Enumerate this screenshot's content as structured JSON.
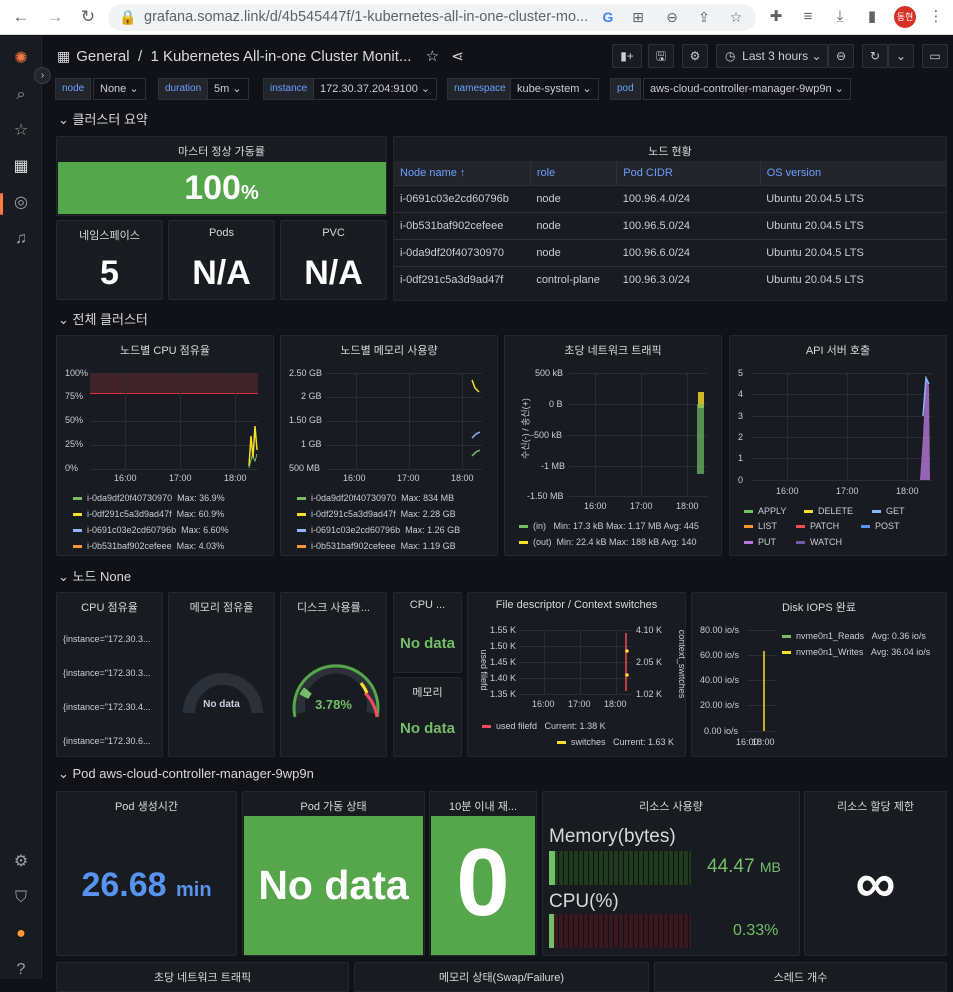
{
  "browser": {
    "url_host": "grafana.somaz.link",
    "url_path": "/d/4b545447f/1-kubernetes-all-in-one-cluster-mo...",
    "profile_initials": "동현"
  },
  "dashboard": {
    "folder": "General",
    "title": "1 Kubernetes All-in-one Cluster Monit...",
    "time_range": "Last 3 hours"
  },
  "variables": [
    {
      "label": "node",
      "value": "None"
    },
    {
      "label": "duration",
      "value": "5m"
    },
    {
      "label": "instance",
      "value": "172.30.37.204:9100"
    },
    {
      "label": "namespace",
      "value": "kube-system"
    },
    {
      "label": "pod",
      "value": "aws-cloud-controller-manager-9wp9n"
    }
  ],
  "rows": {
    "summary": "클러스터 요약",
    "cluster": "전체 클러스터",
    "node": "노드 None",
    "pod": "Pod aws-cloud-controller-manager-9wp9n"
  },
  "summary": {
    "uptime_title": "마스터 정상 가동률",
    "uptime_value": "100",
    "uptime_unit": "%",
    "ns_title": "네임스페이스",
    "ns_value": "5",
    "pods_title": "Pods",
    "pods_value": "N/A",
    "pvc_title": "PVC",
    "pvc_value": "N/A",
    "nodes_title": "노드 현황",
    "nodes_columns": [
      "Node name ↑",
      "role",
      "Pod CIDR",
      "OS version"
    ],
    "nodes_rows": [
      [
        "i-0691c03e2cd60796b",
        "node",
        "100.96.4.0/24",
        "Ubuntu 20.04.5 LTS"
      ],
      [
        "i-0b531baf902cefeee",
        "node",
        "100.96.5.0/24",
        "Ubuntu 20.04.5 LTS"
      ],
      [
        "i-0da9df20f40730970",
        "node",
        "100.96.6.0/24",
        "Ubuntu 20.04.5 LTS"
      ],
      [
        "i-0df291c5a3d9ad47f",
        "control-plane",
        "100.96.3.0/24",
        "Ubuntu 20.04.5 LTS"
      ]
    ]
  },
  "cluster": {
    "cpu": {
      "title": "노드별 CPU 점유율",
      "yticks": [
        "100%",
        "75%",
        "50%",
        "25%",
        "0%"
      ],
      "xticks": [
        "16:00",
        "17:00",
        "18:00"
      ],
      "legend": [
        {
          "name": "i-0da9df20f40730970",
          "stat": "Max: 36.9%",
          "color": "#73bf69"
        },
        {
          "name": "i-0df291c5a3d9ad47f",
          "stat": "Max: 60.9%",
          "color": "#fade2a"
        },
        {
          "name": "i-0691c03e2cd60796b",
          "stat": "Max: 6.60%",
          "color": "#8ab8ff"
        },
        {
          "name": "i-0b531baf902cefeee",
          "stat": "Max: 4.03%",
          "color": "#ff9830"
        }
      ]
    },
    "mem": {
      "title": "노드별 메모리 사용량",
      "yticks": [
        "2.50 GB",
        "2 GB",
        "1.50 GB",
        "1 GB",
        "500 MB"
      ],
      "xticks": [
        "16:00",
        "17:00",
        "18:00"
      ],
      "legend": [
        {
          "name": "i-0da9df20f40730970",
          "stat": "Max: 834 MB",
          "color": "#73bf69"
        },
        {
          "name": "i-0df291c5a3d9ad47f",
          "stat": "Max: 2.28 GB",
          "color": "#fade2a"
        },
        {
          "name": "i-0691c03e2cd60796b",
          "stat": "Max: 1.26 GB",
          "color": "#8ab8ff"
        },
        {
          "name": "i-0b531baf902cefeee",
          "stat": "Max: 1.19 GB",
          "color": "#ff9830"
        }
      ]
    },
    "net": {
      "title": "초당 네트워크 트래픽",
      "ylabel": "수신(-) / 송신(+)",
      "yticks": [
        "500 kB",
        "0 B",
        "-500 kB",
        "-1 MB",
        "-1.50 MB"
      ],
      "xticks": [
        "16:00",
        "17:00",
        "18:00"
      ],
      "legend": [
        {
          "name": "(in)",
          "stat": "Min: 17.3 kB  Max: 1.17 MB  Avg: 445",
          "color": "#73bf69"
        },
        {
          "name": "(out)",
          "stat": "Min: 22.4 kB  Max: 188 kB  Avg: 140",
          "color": "#fade2a"
        }
      ]
    },
    "api": {
      "title": "API 서버 호출",
      "yticks": [
        "5",
        "4",
        "3",
        "2",
        "1",
        "0"
      ],
      "xticks": [
        "16:00",
        "17:00",
        "18:00"
      ],
      "legend": [
        {
          "name": "APPLY",
          "color": "#73bf69"
        },
        {
          "name": "DELETE",
          "color": "#fade2a"
        },
        {
          "name": "GET",
          "color": "#8ab8ff"
        },
        {
          "name": "LIST",
          "color": "#ff9830"
        },
        {
          "name": "PATCH",
          "color": "#f2495c"
        },
        {
          "name": "POST",
          "color": "#5794f2"
        },
        {
          "name": "PUT",
          "color": "#b877d9"
        },
        {
          "name": "WATCH",
          "color": "#705da0"
        }
      ]
    }
  },
  "node": {
    "cpu_title": "CPU 점유율",
    "cpu_lines": [
      "{instance=\"172.30.3...",
      "{instance=\"172.30.3...",
      "{instance=\"172.30.4...",
      "{instance=\"172.30.6..."
    ],
    "mem_title": "메모리 점유율",
    "mem_value": "No data",
    "disk_title": "디스크 사용률...",
    "disk_value": "3.78%",
    "disk_fraction": 0.0378,
    "cpu2_title": "CPU ...",
    "cpu2_value": "No data",
    "mem2_title": "메모리",
    "mem2_value": "No data",
    "fd": {
      "title": "File descriptor / Context switches",
      "left_label": "used filefd",
      "right_label": "context_switches",
      "yticks": [
        "1.55 K",
        "1.50 K",
        "1.45 K",
        "1.40 K",
        "1.35 K"
      ],
      "yticks_right": [
        "4.10 K",
        "2.05 K",
        "1.02 K"
      ],
      "xticks": [
        "16:00",
        "17:00",
        "18:00"
      ],
      "legend": [
        {
          "name": "used filefd",
          "stat": "Current: 1.38 K",
          "color": "#f2495c"
        },
        {
          "name": "switches",
          "stat": "Current: 1.63 K",
          "color": "#fade2a"
        }
      ]
    },
    "iops": {
      "title": "Disk IOPS 완료",
      "yticks": [
        "80.00 io/s",
        "60.00 io/s",
        "40.00 io/s",
        "20.00 io/s",
        "0.00 io/s"
      ],
      "xticks": [
        "16:00",
        "18:00"
      ],
      "legend": [
        {
          "name": "nvme0n1_Reads",
          "stat": "Avg: 0.36 io/s",
          "color": "#73bf69"
        },
        {
          "name": "nvme0n1_Writes",
          "stat": "Avg: 36.04 io/s",
          "color": "#fade2a"
        }
      ]
    }
  },
  "pod": {
    "age_title": "Pod 생성시간",
    "age_value": "26.68",
    "age_unit": "min",
    "status_title": "Pod 가동 상태",
    "status_value": "No data",
    "restart_title": "10분 이내 재...",
    "restart_value": "0",
    "res_title": "리소스 사용량",
    "res_mem_label": "Memory(bytes)",
    "res_mem_value": "44.47",
    "res_mem_unit": "MB",
    "res_cpu_label": "CPU(%)",
    "res_cpu_value": "0.33%",
    "limit_title": "리소스 할당 제한",
    "limit_value": "∞"
  },
  "bottom_titles": [
    "초당 네트워크 트래픽",
    "메모리 상태(Swap/Failure)",
    "스레드 개수"
  ]
}
